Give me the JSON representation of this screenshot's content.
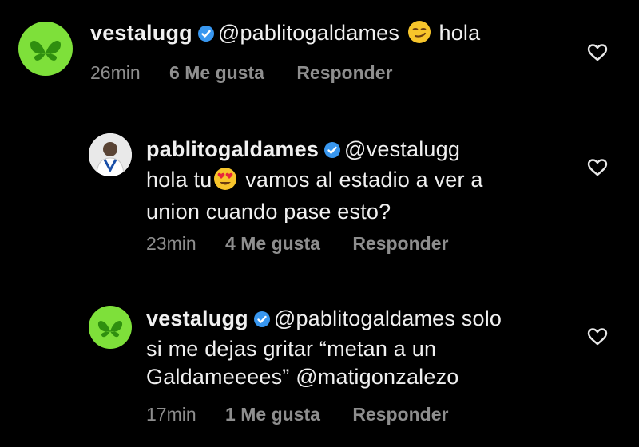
{
  "comments": [
    {
      "username": "vestalugg",
      "mention": "@pablitogaldames",
      "text_after_emoji": "hola",
      "emoji": "smirk-emoji",
      "time": "26min",
      "likes": "6 Me gusta",
      "reply": "Responder"
    },
    {
      "username": "pablitogaldames",
      "mention": "@vestalugg",
      "line2_before_emoji": "hola tu",
      "emoji": "heart-eyes-emoji",
      "line2_after_emoji": "vamos al estadio a ver a",
      "line3": "union cuando pase esto?",
      "time": "23min",
      "likes": "4 Me gusta",
      "reply": "Responder"
    },
    {
      "username": "vestalugg",
      "mention": "@pablitogaldames solo",
      "line2": "si me dejas gritar “metan a un",
      "line3": "Galdameeees” @matigonzalezo",
      "time": "17min",
      "likes": "1 Me gusta",
      "reply": "Responder"
    }
  ],
  "colors": {
    "background": "#000000",
    "text": "#f0f0f0",
    "meta": "#8e8e8e",
    "verified": "#3897f0",
    "avatar_green": "#7ee03a"
  }
}
